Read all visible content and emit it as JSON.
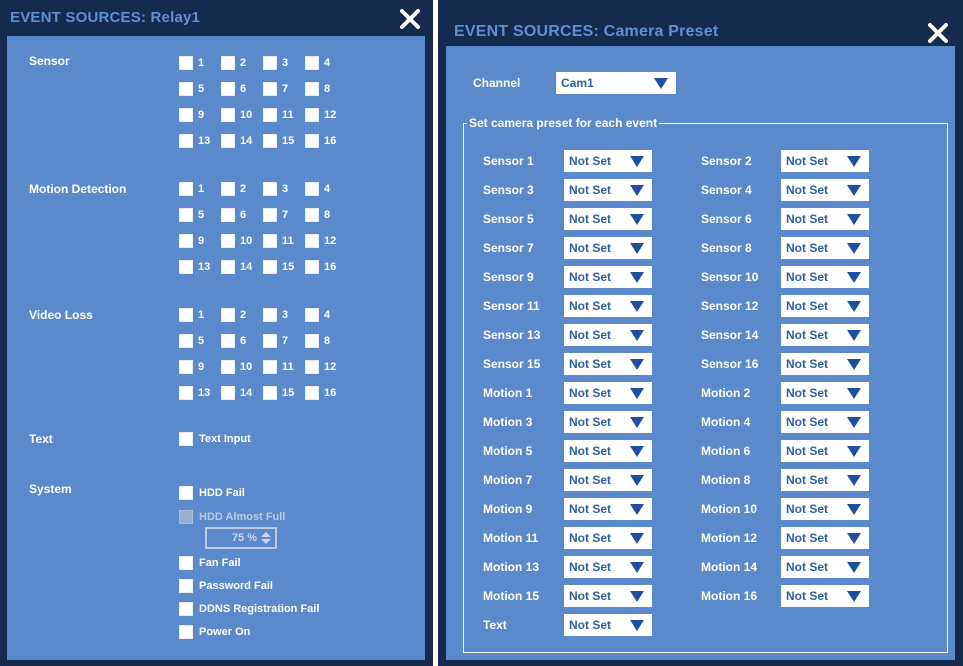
{
  "left_panel": {
    "title": "EVENT SOURCES: Relay1",
    "close_icon": "close-x-icon",
    "sensor": {
      "label": "Sensor",
      "numbers": [
        "1",
        "2",
        "3",
        "4",
        "5",
        "6",
        "7",
        "8",
        "9",
        "10",
        "11",
        "12",
        "13",
        "14",
        "15",
        "16"
      ]
    },
    "motion": {
      "label": "Motion Detection",
      "numbers": [
        "1",
        "2",
        "3",
        "4",
        "5",
        "6",
        "7",
        "8",
        "9",
        "10",
        "11",
        "12",
        "13",
        "14",
        "15",
        "16"
      ]
    },
    "video_loss": {
      "label": "Video Loss",
      "numbers": [
        "1",
        "2",
        "3",
        "4",
        "5",
        "6",
        "7",
        "8",
        "9",
        "10",
        "11",
        "12",
        "13",
        "14",
        "15",
        "16"
      ]
    },
    "text": {
      "label": "Text",
      "option": "Text Input"
    },
    "system": {
      "label": "System",
      "hdd_fail": "HDD Fail",
      "hdd_almost_full": "HDD Almost Full",
      "threshold": "75 %",
      "fan_fail": "Fan Fail",
      "password_fail": "Password Fail",
      "ddns_fail": "DDNS Registration Fail",
      "power_on": "Power On"
    }
  },
  "right_panel": {
    "title": "EVENT SOURCES: Camera Preset",
    "close_icon": "close-x-icon",
    "channel": {
      "label": "Channel",
      "value": "Cam1"
    },
    "legend": "Set camera preset for each event",
    "events": [
      {
        "label": "Sensor 1",
        "value": "Not Set"
      },
      {
        "label": "Sensor 2",
        "value": "Not Set"
      },
      {
        "label": "Sensor 3",
        "value": "Not Set"
      },
      {
        "label": "Sensor 4",
        "value": "Not Set"
      },
      {
        "label": "Sensor 5",
        "value": "Not Set"
      },
      {
        "label": "Sensor 6",
        "value": "Not Set"
      },
      {
        "label": "Sensor 7",
        "value": "Not Set"
      },
      {
        "label": "Sensor 8",
        "value": "Not Set"
      },
      {
        "label": "Sensor 9",
        "value": "Not Set"
      },
      {
        "label": "Sensor 10",
        "value": "Not Set"
      },
      {
        "label": "Sensor 11",
        "value": "Not Set"
      },
      {
        "label": "Sensor 12",
        "value": "Not Set"
      },
      {
        "label": "Sensor 13",
        "value": "Not Set"
      },
      {
        "label": "Sensor 14",
        "value": "Not Set"
      },
      {
        "label": "Sensor 15",
        "value": "Not Set"
      },
      {
        "label": "Sensor 16",
        "value": "Not Set"
      },
      {
        "label": "Motion 1",
        "value": "Not Set"
      },
      {
        "label": "Motion 2",
        "value": "Not Set"
      },
      {
        "label": "Motion 3",
        "value": "Not Set"
      },
      {
        "label": "Motion 4",
        "value": "Not Set"
      },
      {
        "label": "Motion 5",
        "value": "Not Set"
      },
      {
        "label": "Motion 6",
        "value": "Not Set"
      },
      {
        "label": "Motion 7",
        "value": "Not Set"
      },
      {
        "label": "Motion 8",
        "value": "Not Set"
      },
      {
        "label": "Motion 9",
        "value": "Not Set"
      },
      {
        "label": "Motion 10",
        "value": "Not Set"
      },
      {
        "label": "Motion 11",
        "value": "Not Set"
      },
      {
        "label": "Motion 12",
        "value": "Not Set"
      },
      {
        "label": "Motion 13",
        "value": "Not Set"
      },
      {
        "label": "Motion 14",
        "value": "Not Set"
      },
      {
        "label": "Motion 15",
        "value": "Not Set"
      },
      {
        "label": "Motion 16",
        "value": "Not Set"
      },
      {
        "label": "Text",
        "value": "Not Set"
      }
    ]
  },
  "colors": {
    "frame": "#152a4f",
    "body": "#5a8acb",
    "title_text": "#5f8fd4",
    "dropdown_text": "#2f5f9f",
    "arrow": "#1f4fa0"
  }
}
